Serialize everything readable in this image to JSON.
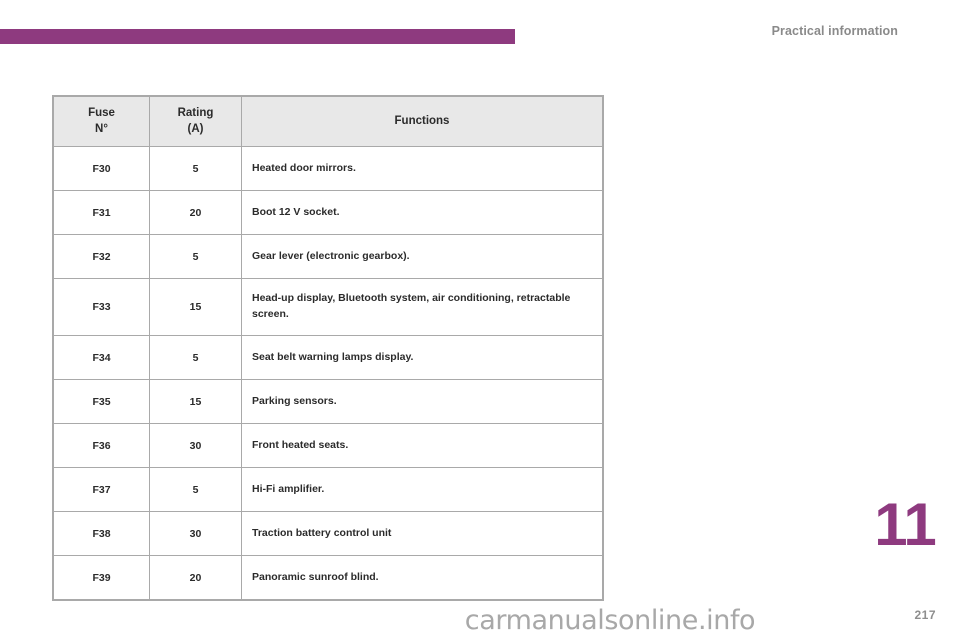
{
  "header": {
    "title": "Practical information",
    "rule_color": "#8e3a7f"
  },
  "table": {
    "columns": [
      {
        "key": "fuse_no",
        "label_line1": "Fuse",
        "label_line2": "N°"
      },
      {
        "key": "rating",
        "label_line1": "Rating",
        "label_line2": "(A)"
      },
      {
        "key": "functions",
        "label_line1": "Functions",
        "label_line2": ""
      }
    ],
    "rows": [
      {
        "fuse_no": "F30",
        "rating": "5",
        "functions": "Heated door mirrors."
      },
      {
        "fuse_no": "F31",
        "rating": "20",
        "functions": "Boot 12 V socket."
      },
      {
        "fuse_no": "F32",
        "rating": "5",
        "functions": "Gear lever (electronic gearbox)."
      },
      {
        "fuse_no": "F33",
        "rating": "15",
        "functions": "Head-up display, Bluetooth system, air conditioning, retractable screen."
      },
      {
        "fuse_no": "F34",
        "rating": "5",
        "functions": "Seat belt warning lamps display."
      },
      {
        "fuse_no": "F35",
        "rating": "15",
        "functions": "Parking sensors."
      },
      {
        "fuse_no": "F36",
        "rating": "30",
        "functions": "Front heated seats."
      },
      {
        "fuse_no": "F37",
        "rating": "5",
        "functions": "Hi-Fi amplifier."
      },
      {
        "fuse_no": "F38",
        "rating": "30",
        "functions": "Traction battery control unit"
      },
      {
        "fuse_no": "F39",
        "rating": "20",
        "functions": "Panoramic sunroof blind."
      }
    ]
  },
  "chapter": {
    "number": "11",
    "color": "#8e3a7f"
  },
  "footer": {
    "page_number": "217",
    "watermark": "carmanualsonline.info"
  }
}
